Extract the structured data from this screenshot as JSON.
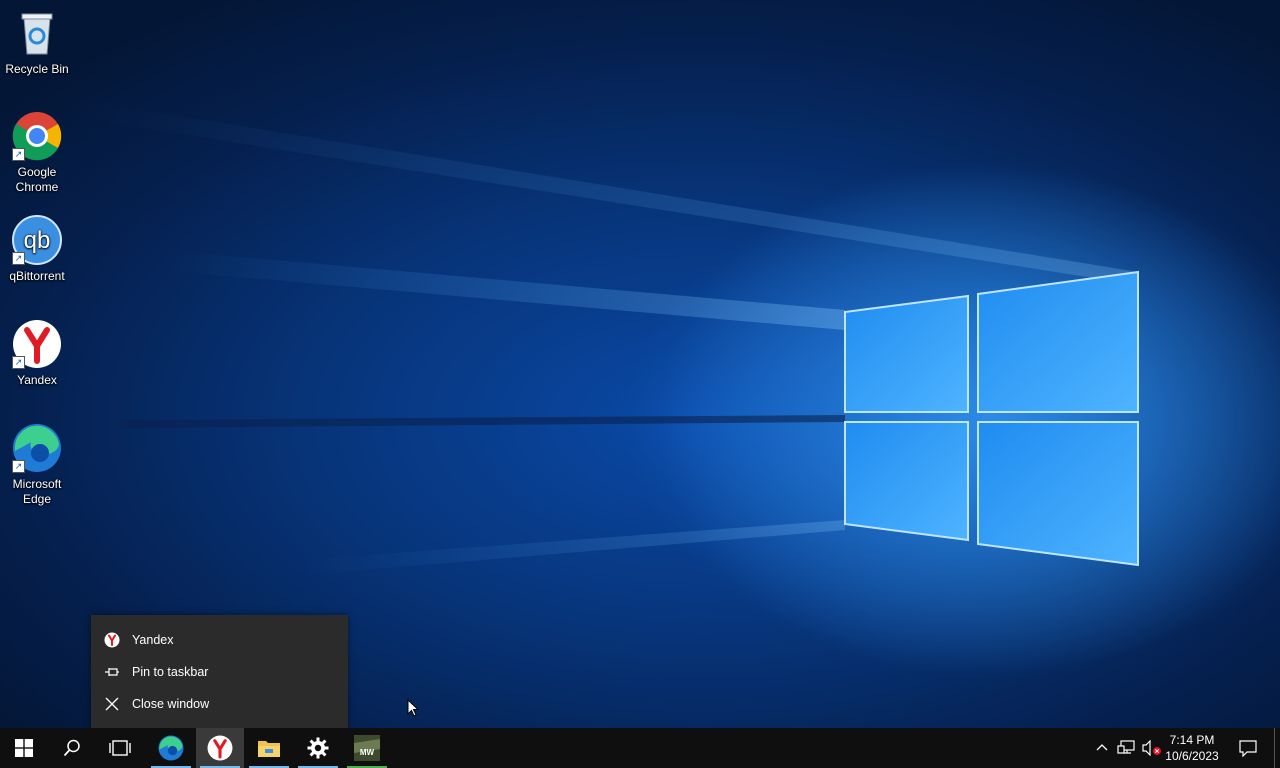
{
  "desktop": {
    "icons": [
      {
        "label": "Recycle Bin"
      },
      {
        "label": "Google Chrome"
      },
      {
        "label": "qBittorrent"
      },
      {
        "label": "Yandex"
      },
      {
        "label": "Microsoft Edge"
      }
    ]
  },
  "jump_list": {
    "app_name": "Yandex",
    "pin_label": "Pin to taskbar",
    "close_label": "Close window"
  },
  "taskbar": {
    "apps": [
      {
        "icon": "edge-icon",
        "running": true
      },
      {
        "icon": "yandex-icon",
        "running": true,
        "active": true
      },
      {
        "icon": "file-explorer-icon",
        "running": true
      },
      {
        "icon": "settings-icon",
        "running": true
      },
      {
        "icon": "game-mw-icon",
        "running": true
      }
    ],
    "clock": {
      "time": "7:14 PM",
      "date": "10/6/2023"
    },
    "colors": {
      "taskbar_bg": "#0f0f10",
      "running_underline": "#76b9ed",
      "active_bg": "#3a3a3a"
    }
  }
}
